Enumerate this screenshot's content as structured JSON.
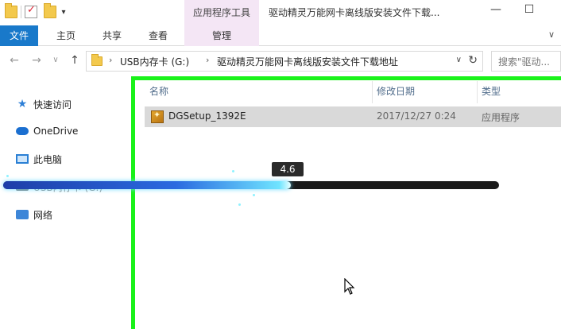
{
  "titlebar": {
    "context_tab": "应用程序工具",
    "window_title": "驱动精灵万能网卡离线版安装文件下载...",
    "minimize": "—",
    "maximize": "☐"
  },
  "ribbon": {
    "tabs": [
      "文件",
      "主页",
      "共享",
      "查看",
      "管理"
    ],
    "help_chevron": "∨"
  },
  "address": {
    "back": "←",
    "forward": "→",
    "recent": "∨",
    "up": "↑",
    "crumbs": [
      "USB内存卡 (G:)",
      "驱动精灵万能网卡离线版安装文件下载地址"
    ],
    "crumb_sep": "›",
    "dropdown": "∨",
    "refresh": "↻",
    "search_placeholder": "搜索\"驱动..."
  },
  "nav": {
    "items": [
      "快速访问",
      "OneDrive",
      "此电脑",
      "USB内存卡 (G:)",
      "网络"
    ]
  },
  "columns": {
    "name": "名称",
    "date": "修改日期",
    "type": "类型"
  },
  "files": [
    {
      "name": "DGSetup_1392E",
      "date": "2017/12/27 0:24",
      "type": "应用程序"
    }
  ],
  "progress": {
    "label": "4.6",
    "fraction": 0.58
  }
}
